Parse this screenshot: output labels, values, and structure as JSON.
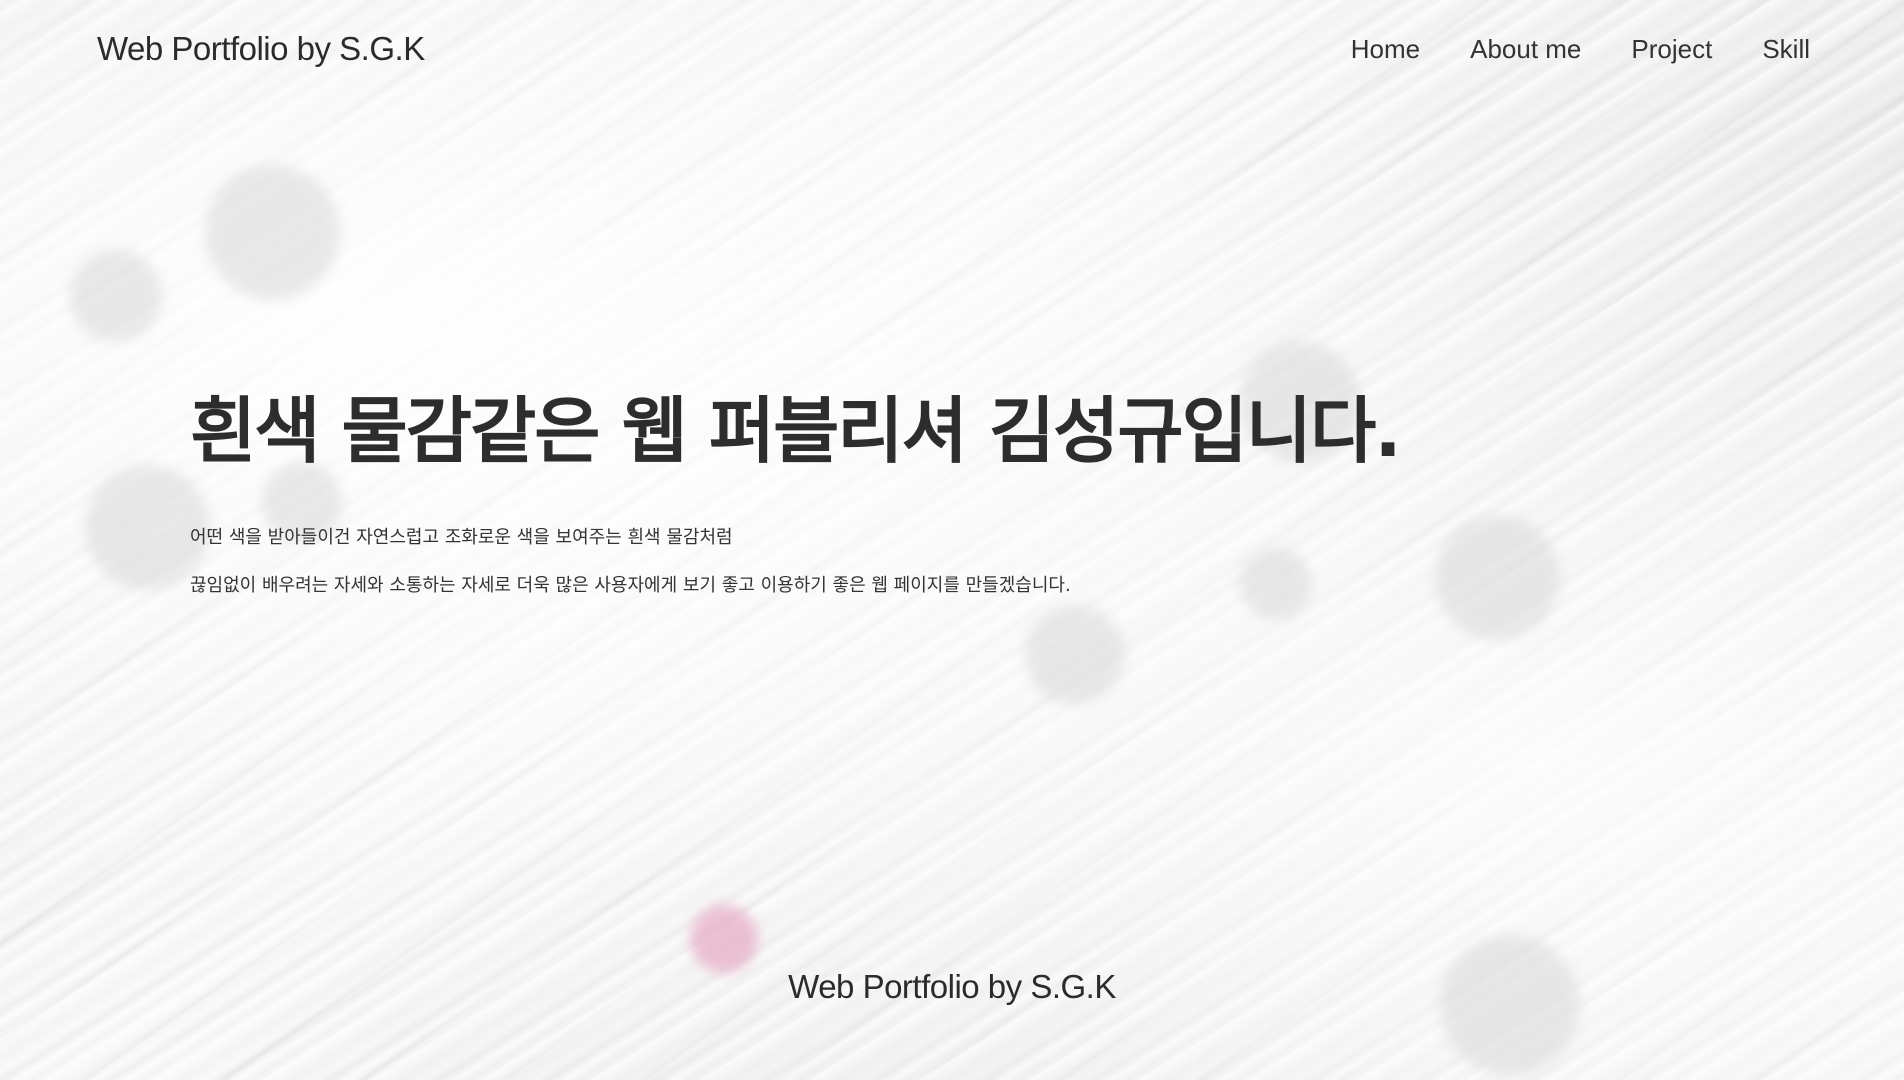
{
  "header": {
    "logo": "Web Portfolio by S.G.K",
    "nav": [
      {
        "label": "Home"
      },
      {
        "label": "About me"
      },
      {
        "label": "Project"
      },
      {
        "label": "Skill"
      }
    ]
  },
  "hero": {
    "title": "흰색 물감같은 웹 퍼블리셔 김성규입니다.",
    "line1": "어떤 색을 받아들이건 자연스럽고 조화로운 색을 보여주는 흰색 물감처럼",
    "line2": "끊임없이 배우려는 자세와 소통하는 자세로 더욱 많은 사용자에게 보기 좋고 이용하기 좋은 웹 페이지를 만들겠습니다."
  },
  "footer": {
    "text": "Web Portfolio by S.G.K"
  },
  "colors": {
    "text": "#2b2b2b",
    "background": "#f7f7f7",
    "blob_gray": "#d9d9d9",
    "blob_pink": "#e6a9c4"
  }
}
